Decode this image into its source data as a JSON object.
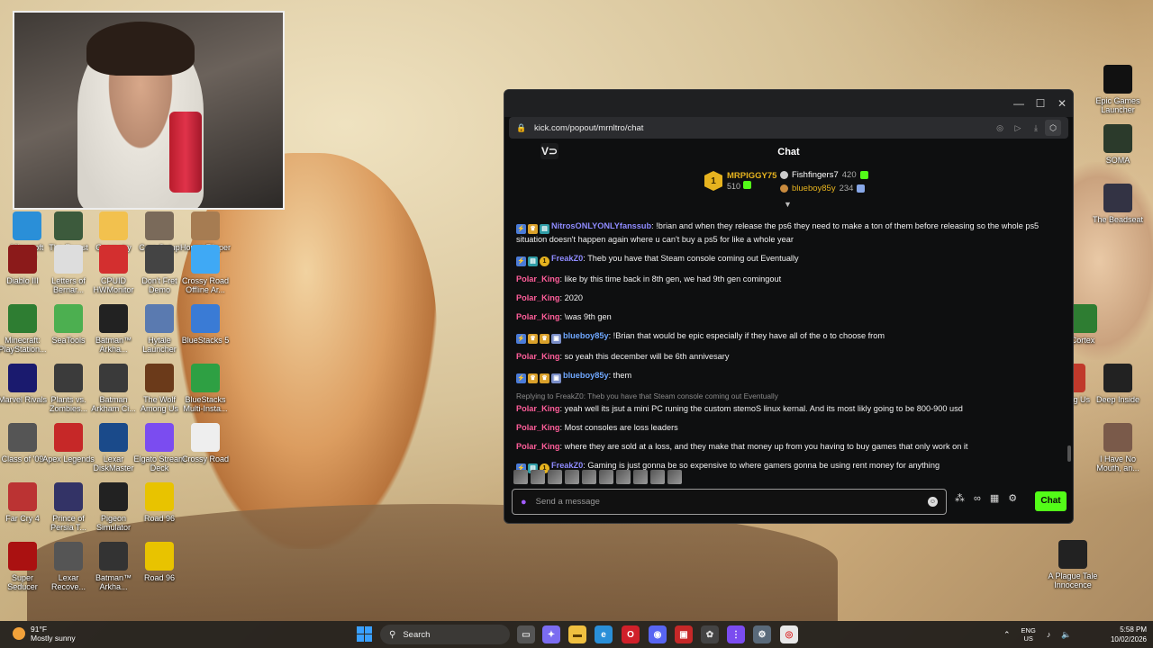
{
  "browser": {
    "url": "kick.com/popout/mrnltro/chat"
  },
  "chat": {
    "title": "Chat",
    "logo": "V⊃",
    "leaderboard": {
      "first": {
        "rank": "1",
        "name": "MRPIGGY75",
        "points": "510"
      },
      "second": {
        "name": "Fishfingers7",
        "points": "420"
      },
      "third": {
        "name": "blueboy85y",
        "points": "234"
      }
    },
    "messages": [
      {
        "user": "NitrosONLYONLYfanssub",
        "color": "purple",
        "badges": [
          "blue",
          "crown",
          "cyan"
        ],
        "text": ": !brian and when they release the ps6 they need to make a ton of them before releasing so the whole ps5 situation doesn't happen again where u can't buy a ps5 for like a whole year"
      },
      {
        "user": "FreakZ0",
        "color": "purple",
        "badges": [
          "blue",
          "cyan",
          "gold"
        ],
        "text": ": Theb you have that Steam console coming out Eventually"
      },
      {
        "user": "Polar_King",
        "color": "pink",
        "badges": [],
        "text": ": like by this time back in 8th gen, we had 9th gen comingout"
      },
      {
        "user": "Polar_King",
        "color": "pink",
        "badges": [],
        "text": ": 2020"
      },
      {
        "user": "Polar_King",
        "color": "pink",
        "badges": [],
        "text": ": \\was 9th gen"
      },
      {
        "user": "blueboy85y",
        "color": "blue",
        "badges": [
          "blue",
          "crown",
          "crown",
          "bot"
        ],
        "text": ": !Brian that would be epic especially if they have all of the o to choose from"
      },
      {
        "user": "Polar_King",
        "color": "pink",
        "badges": [],
        "text": ": so yeah this december will be 6th annivesary"
      },
      {
        "user": "blueboy85y",
        "color": "blue",
        "badges": [
          "blue",
          "crown",
          "crown",
          "bot"
        ],
        "text": ": them"
      },
      {
        "reply": "Replying to FreakZ0: Theb you have that Steam console coming out Eventually",
        "user": "Polar_King",
        "color": "pink",
        "badges": [],
        "text": ": yeah well its jsut a mini PC runing the custom stemoS linux kernal. And its most likly going to be 800-900 usd"
      },
      {
        "user": "Polar_King",
        "color": "pink",
        "badges": [],
        "text": ": Most consoles are loss leaders"
      },
      {
        "user": "Polar_King",
        "color": "pink",
        "badges": [],
        "text": ": where they are sold at a loss, and they make that money up from you having to buy games that only work on it"
      },
      {
        "user": "FreakZ0",
        "color": "purple",
        "badges": [
          "blue",
          "cyan",
          "gold"
        ],
        "text": ": Gaming is just gonna be so expensive to where gamers gonna be using rent money for anything"
      }
    ],
    "input_placeholder": "Send a message",
    "send_label": "Chat"
  },
  "desktop_icons": [
    {
      "label": "Microsoft Edge"
    },
    {
      "label": "The Forest"
    },
    {
      "label": "Geometry Dash"
    },
    {
      "label": "Core Setup"
    },
    {
      "label": "House Flipper"
    },
    {
      "label": "Diablo III"
    },
    {
      "label": "Letters of Bernar..."
    },
    {
      "label": "CPUID HWMonitor"
    },
    {
      "label": "Don't Fret Demo"
    },
    {
      "label": "Crossy Road Offline Ar..."
    },
    {
      "label": "Minecraft: PlayStation..."
    },
    {
      "label": "SeaTools"
    },
    {
      "label": "Batman™ Arkha..."
    },
    {
      "label": "Hytale Launcher"
    },
    {
      "label": "BlueStacks 5"
    },
    {
      "label": "Marvel Rivals"
    },
    {
      "label": "Plants vs. Zombies..."
    },
    {
      "label": "Batman Arkham Ci..."
    },
    {
      "label": "The Wolf Among Us"
    },
    {
      "label": "BlueStacks Multi-Insta..."
    },
    {
      "label": "Class of '09"
    },
    {
      "label": "Apex Legends"
    },
    {
      "label": "Lexar DiskMaster"
    },
    {
      "label": "Elgato Stream Deck"
    },
    {
      "label": "Crossy Road"
    },
    {
      "label": "Far Cry 4"
    },
    {
      "label": "Prince of Persia T..."
    },
    {
      "label": "Pigeon Simulator"
    },
    {
      "label": "Road 96"
    },
    {
      "label": "Super Seducer"
    },
    {
      "label": "Lexar Recove..."
    },
    {
      "label": "Batman™ Arkha..."
    },
    {
      "label": "Road 96"
    },
    {
      "label": "Epic Games Launcher"
    },
    {
      "label": "SOMA"
    },
    {
      "label": "The Beadseat"
    },
    {
      "label": "Cortex"
    },
    {
      "label": "Among Us"
    },
    {
      "label": "Deep Inside"
    },
    {
      "label": "I Have No Mouth, an..."
    },
    {
      "label": "A Plague Tale Innocence"
    }
  ],
  "taskbar": {
    "temp": "91°F",
    "weather": "Mostly sunny",
    "search": "Search",
    "lang1": "ENG",
    "lang2": "US",
    "time": "5:58 PM",
    "date": "10/02/2026"
  }
}
